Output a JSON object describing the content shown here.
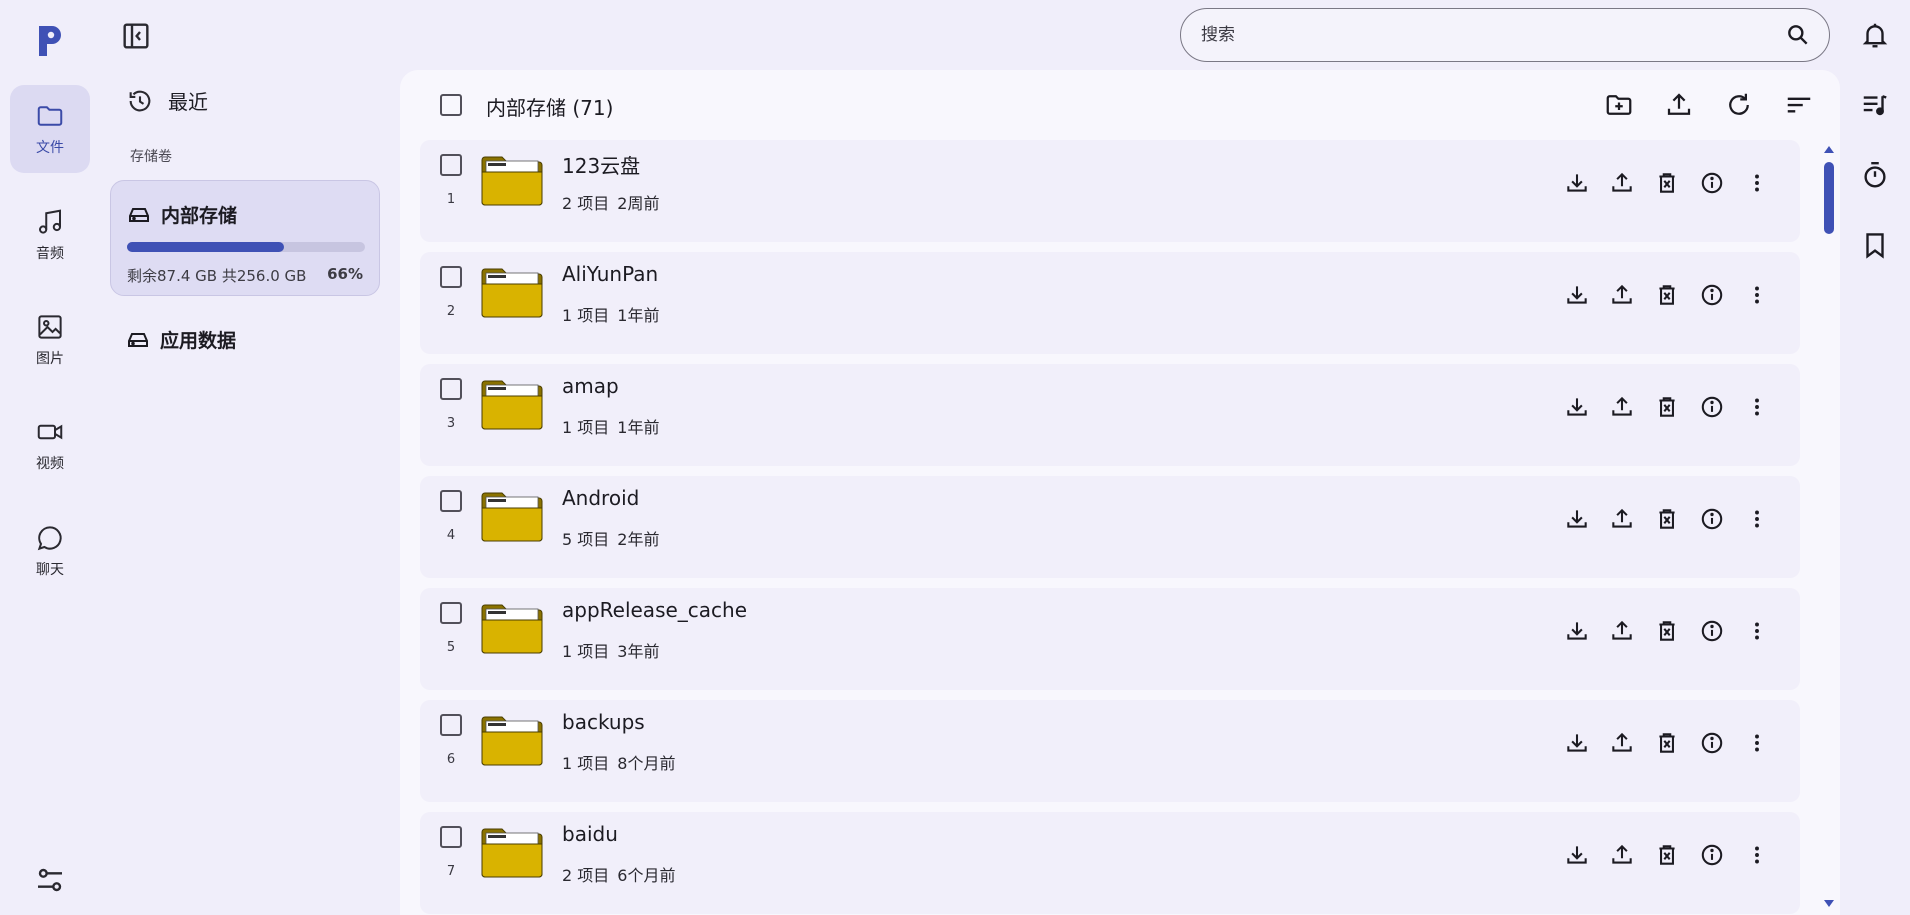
{
  "nav": {
    "items": [
      {
        "label": "文件",
        "icon": "folder-icon",
        "active": true
      },
      {
        "label": "音频",
        "icon": "music-note-icon",
        "active": false
      },
      {
        "label": "图片",
        "icon": "image-icon",
        "active": false
      },
      {
        "label": "视频",
        "icon": "video-camera-icon",
        "active": false
      },
      {
        "label": "聊天",
        "icon": "chat-bubble-icon",
        "active": false
      }
    ]
  },
  "sidebar": {
    "recent_label": "最近",
    "volumes_label": "存储卷",
    "storage": {
      "title": "内部存储",
      "info": "剩余87.4 GB 共256.0 GB",
      "percent_label": "66%",
      "used_fraction": 0.66
    },
    "app_data_label": "应用数据"
  },
  "search": {
    "placeholder": "搜索"
  },
  "main": {
    "title": "内部存储 (71)",
    "files": [
      {
        "index": "1",
        "name": "123云盘",
        "count": "2 项目",
        "age": "2周前"
      },
      {
        "index": "2",
        "name": "AliYunPan",
        "count": "1 项目",
        "age": "1年前"
      },
      {
        "index": "3",
        "name": "amap",
        "count": "1 项目",
        "age": "1年前"
      },
      {
        "index": "4",
        "name": "Android",
        "count": "5 项目",
        "age": "2年前"
      },
      {
        "index": "5",
        "name": "appRelease_cache",
        "count": "1 项目",
        "age": "3年前"
      },
      {
        "index": "6",
        "name": "backups",
        "count": "1 项目",
        "age": "8个月前"
      },
      {
        "index": "7",
        "name": "baidu",
        "count": "2 项目",
        "age": "6个月前"
      }
    ]
  },
  "colors": {
    "accent": "#3f51b5",
    "folder": "#d9b300",
    "active_nav": "#dcdaf2",
    "background": "#f0eefa"
  }
}
